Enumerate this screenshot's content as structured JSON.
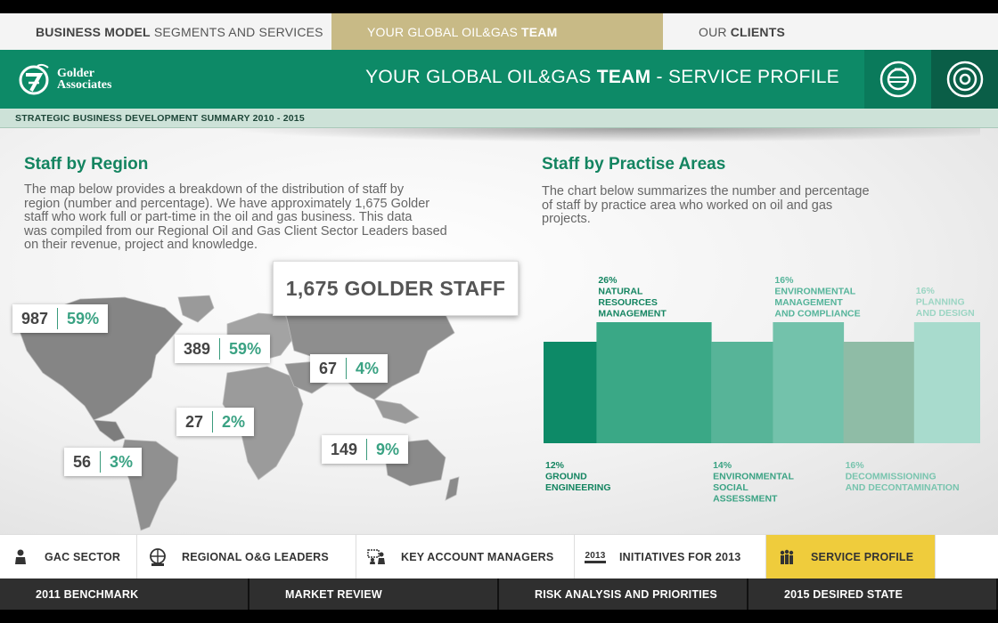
{
  "top_tabs": [
    {
      "bold": "BUSINESS MODEL",
      "rest": "SEGMENTS AND SERVICES"
    },
    {
      "pre": "YOUR GLOBAL OIL&GAS",
      "bold": "TEAM"
    },
    {
      "pre": "OUR",
      "bold": "CLIENTS"
    }
  ],
  "header": {
    "logo_line1": "Golder",
    "logo_line2": "Associates",
    "title_pre": "YOUR GLOBAL OIL&GAS",
    "title_bold": "TEAM",
    "title_post": " - SERVICE PROFILE",
    "icon1": "globe-icon",
    "icon2": "target-icon"
  },
  "subbar": "STRATEGIC BUSINESS DEVELOPMENT SUMMARY 2010 - 2015",
  "staff_by_region": {
    "title": "Staff by Region",
    "description_lines": [
      "The map below provides a breakdown of the distribution of staff by",
      "region (number and percentage). We have approximately 1,675 Golder",
      "staff who work full or part-time in the oil and gas business.  This data",
      "was compiled from our Regional Oil and Gas Client Sector Leaders based",
      "on their revenue, project and knowledge."
    ],
    "total": "1,675 GOLDER STAFF",
    "callouts": [
      {
        "num": "987",
        "pct": "59%"
      },
      {
        "num": "389",
        "pct": "59%"
      },
      {
        "num": "67",
        "pct": "4%"
      },
      {
        "num": "27",
        "pct": "2%"
      },
      {
        "num": "56",
        "pct": "3%"
      },
      {
        "num": "149",
        "pct": "9%"
      }
    ]
  },
  "staff_by_practise": {
    "title": "Staff by Practise Areas",
    "description_lines": [
      "The chart below summarizes the number and percentage",
      "of staff by practice area who worked on oil and gas",
      "projects."
    ]
  },
  "chart_data": {
    "type": "bar",
    "categories": [
      "GROUND ENGINEERING",
      "NATURAL RESOURCES MANAGEMENT",
      "ENVIRONMENTAL SOCIAL ASSESSMENT",
      "ENVIRONMENTAL MANAGEMENT AND COMPLIANCE",
      "DECOMMISSIONING AND DECONTAMINATION",
      "PLANNING AND DESIGN"
    ],
    "values": [
      12,
      26,
      14,
      16,
      16,
      16
    ],
    "value_labels": [
      "12%",
      "26%",
      "14%",
      "16%",
      "16%",
      "16%"
    ],
    "label_lines": [
      [
        "12%",
        "GROUND",
        "ENGINEERING"
      ],
      [
        "26%",
        "NATURAL",
        "RESOURCES",
        "MANAGEMENT"
      ],
      [
        "14%",
        "ENVIRONMENTAL",
        "SOCIAL",
        "ASSESSMENT"
      ],
      [
        "16%",
        "ENVIRONMENTAL",
        "MANAGEMENT",
        "AND COMPLIANCE"
      ],
      [
        "16%",
        "DECOMMISSIONING",
        "AND DECONTAMINATION"
      ],
      [
        "16%",
        "PLANNING",
        "AND DESIGN"
      ]
    ],
    "label_position": [
      "below",
      "above",
      "below",
      "above",
      "below",
      "above"
    ],
    "colors": [
      "#0d8a67",
      "#3aa886",
      "#57b498",
      "#73c2ab",
      "#8fbca6",
      "#a8dbcd"
    ],
    "label_colors": [
      "#138460",
      "#138460",
      "#3aa283",
      "#55b49a",
      "#78c4ae",
      "#9bd5c3"
    ]
  },
  "nav_primary": [
    {
      "label": "GAC SECTOR",
      "icon": "person-icon"
    },
    {
      "label": "REGIONAL O&G LEADERS",
      "icon": "globe-people-icon"
    },
    {
      "label": "KEY ACCOUNT MANAGERS",
      "icon": "presenter-icon"
    },
    {
      "label": "INITIATIVES FOR 2013",
      "icon": "calendar-2013-icon",
      "icon_text": "2013"
    },
    {
      "label": "SERVICE PROFILE",
      "icon": "team-icon"
    }
  ],
  "nav_secondary": [
    "2011 BENCHMARK",
    "MARKET REVIEW",
    "RISK ANALYSIS AND PRIORITIES",
    "2015 DESIRED STATE"
  ]
}
